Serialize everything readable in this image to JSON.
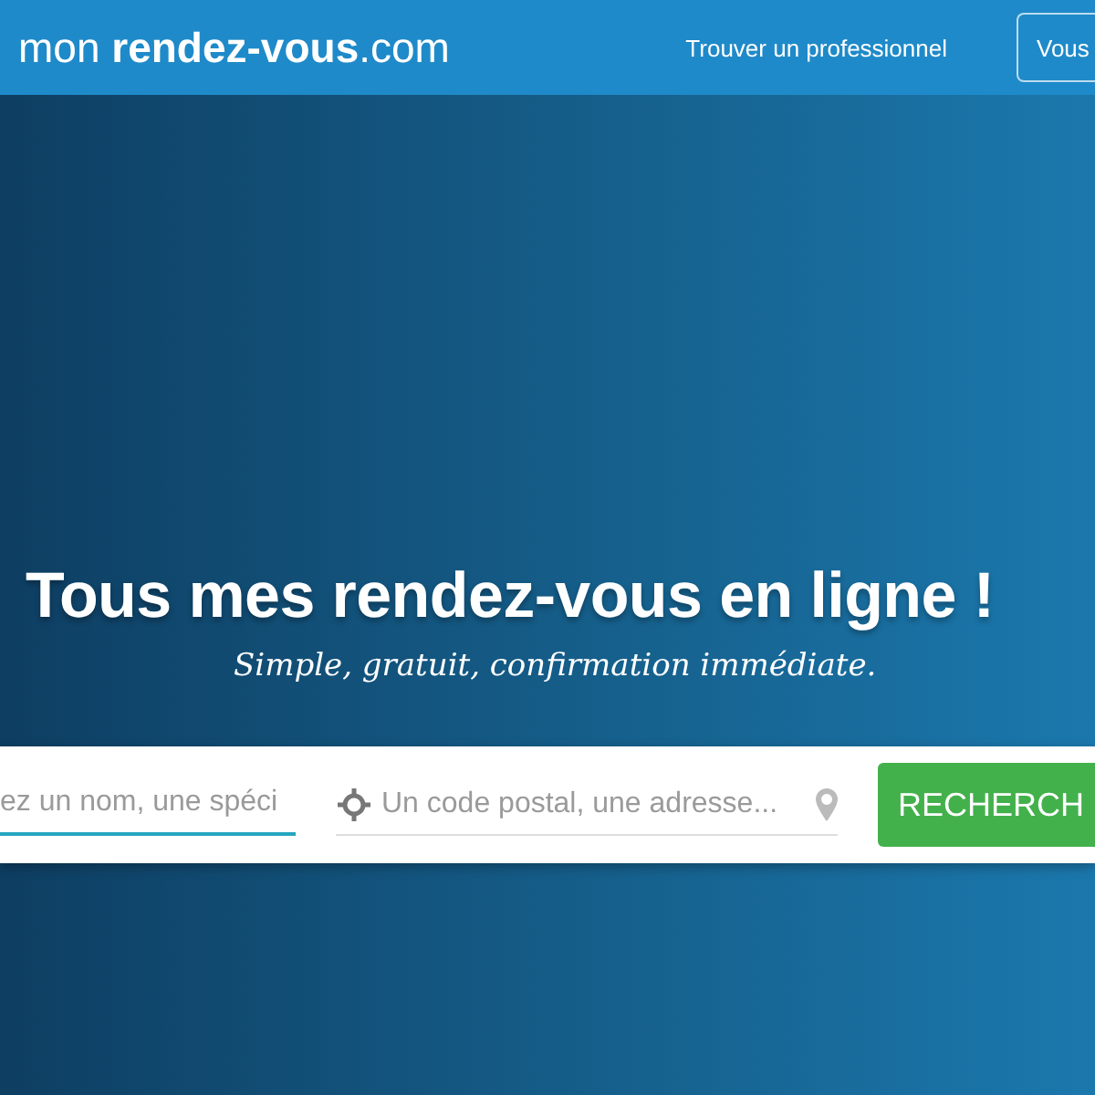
{
  "header": {
    "logo": {
      "light": "mon ",
      "bold": "rendez-vous",
      "suffix": ".com"
    },
    "nav_link": "Trouver un professionnel",
    "account_button": "Vous"
  },
  "hero": {
    "title": "Tous mes rendez-vous en ligne !",
    "subtitle": "Simple, gratuit, confirmation immédiate."
  },
  "search": {
    "what_placeholder": "ez un nom, une spéci",
    "where_placeholder": "Un code postal, une adresse...",
    "button": "RECHERCH"
  }
}
